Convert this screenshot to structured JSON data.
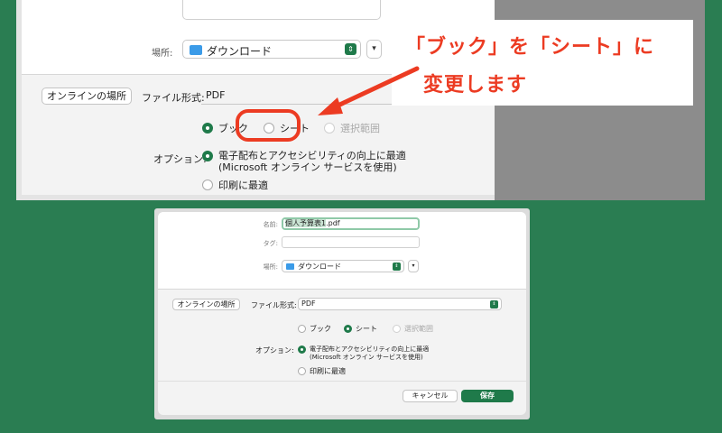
{
  "top": {
    "location_label": "場所:",
    "location_value": "ダウンロード",
    "online_button": "オンラインの場所",
    "format_label": "ファイル形式:",
    "format_value": "PDF",
    "radio_book": "ブック",
    "radio_sheet": "シート",
    "radio_selection": "選択範囲",
    "options_label": "オプション:",
    "option1_line1": "電子配布とアクセシビリティの向上に最適",
    "option1_line2": "(Microsoft オンライン サービスを使用)",
    "option2": "印刷に最適"
  },
  "callout": {
    "line1": "「ブック」を「シート」に",
    "line2": "変更します",
    "color": "#ec3b22"
  },
  "bottom": {
    "name_label": "名前:",
    "name_selected": "個人予算表1",
    "name_ext": ".pdf",
    "tag_label": "タグ:",
    "location_label": "場所:",
    "location_value": "ダウンロード",
    "online_button": "オンラインの場所",
    "format_label": "ファイル形式:",
    "format_value": "PDF",
    "radio_book": "ブック",
    "radio_sheet": "シート",
    "radio_selection": "選択範囲",
    "options_label": "オプション:",
    "option1_line1": "電子配布とアクセシビリティの向上に最適",
    "option1_line2": "(Microsoft オンライン サービスを使用)",
    "option2": "印刷に最適",
    "cancel_button": "キャンセル",
    "save_button": "保存"
  },
  "colors": {
    "background": "#2a7d52",
    "accent": "#1f7a4a",
    "highlight": "#ec3b22"
  }
}
